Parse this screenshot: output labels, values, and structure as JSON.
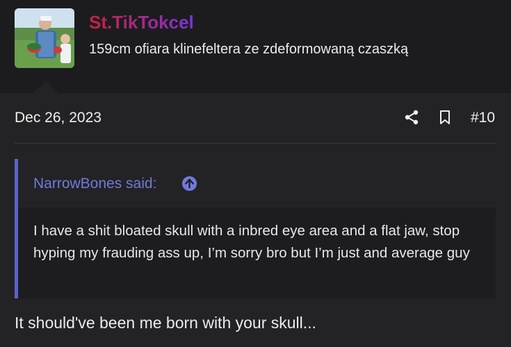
{
  "author": {
    "username": "St.TikTokcel",
    "user_title": "159cm ofiara klinefeltera ze zdeformowaną czaszką",
    "avatar_icon": "user-avatar-photo"
  },
  "post": {
    "date": "Dec 26, 2023",
    "number": "#10",
    "share_icon": "share-icon",
    "bookmark_icon": "bookmark-icon"
  },
  "quote": {
    "author_said": "NarrowBones said:",
    "jump_icon": "arrow-up-circle-icon",
    "body": "I have a shit bloated skull with a inbred eye area and a flat jaw, stop hyping my frauding ass up, I’m sorry bro but I’m just and average guy"
  },
  "content": {
    "text": "It should've been me born with your skull..."
  },
  "colors": {
    "background": "#232325",
    "header_background": "#1c1c1e",
    "quote_accent": "#5a63c8",
    "quote_link": "#6f7bdc",
    "username_gradient": [
      "#c8213f",
      "#7a35d8"
    ]
  }
}
